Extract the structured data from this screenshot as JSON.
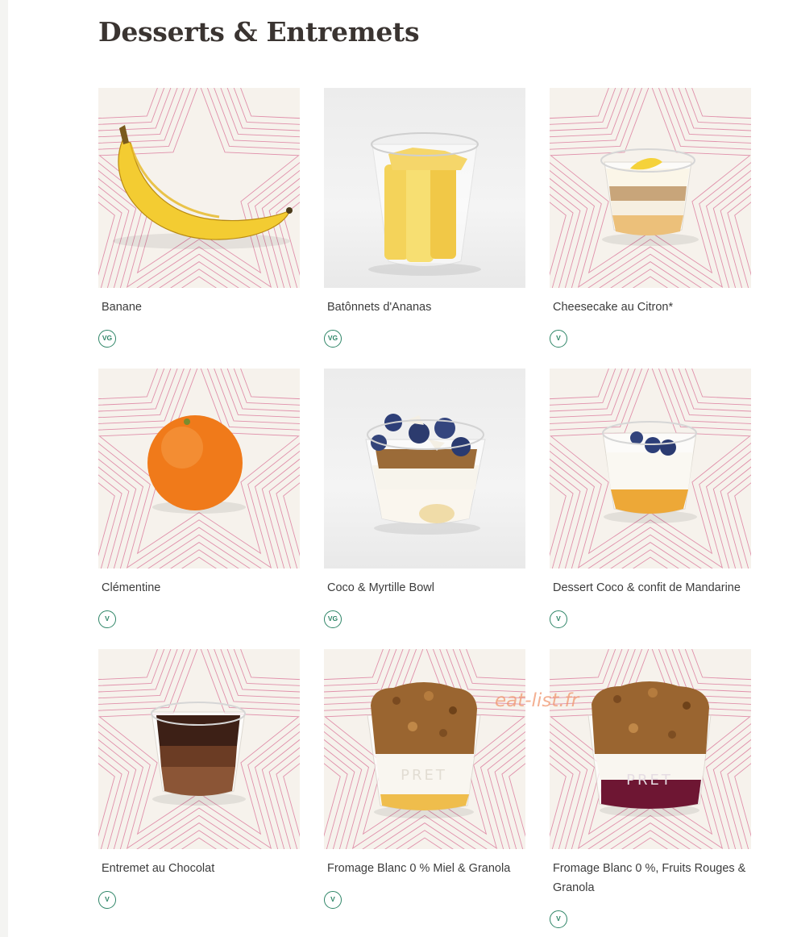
{
  "page": {
    "title": "Desserts & Entremets",
    "watermark": "eat-list.fr"
  },
  "products": [
    {
      "name": "Banane",
      "badge": "VG",
      "image": "banana",
      "background": "star"
    },
    {
      "name": "Batônnets d'Ananas",
      "badge": "VG",
      "image": "pineapple-cup",
      "background": "plain"
    },
    {
      "name": "Cheesecake au Citron*",
      "badge": "V",
      "image": "lemon-cheesecake",
      "background": "star"
    },
    {
      "name": "Clémentine",
      "badge": "V",
      "image": "clementine",
      "background": "star"
    },
    {
      "name": "Coco & Myrtille Bowl",
      "badge": "VG",
      "image": "coconut-blueberry-bowl",
      "background": "plain"
    },
    {
      "name": "Dessert Coco & confit de Mandarine",
      "badge": "V",
      "image": "coconut-mandarin-dessert",
      "background": "star"
    },
    {
      "name": "Entremet au Chocolat",
      "badge": "V",
      "image": "chocolate-dessert",
      "background": "star"
    },
    {
      "name": "Fromage Blanc 0 % Miel & Granola",
      "badge": "V",
      "image": "fromage-blanc-honey-granola",
      "background": "star"
    },
    {
      "name": "Fromage Blanc 0 %, Fruits Rouges & Granola",
      "badge": "V",
      "image": "fromage-blanc-red-fruits-granola",
      "background": "star"
    }
  ],
  "colors": {
    "badge": "#2e8567",
    "star_lines": "#d86f94",
    "title": "#3a3431"
  }
}
